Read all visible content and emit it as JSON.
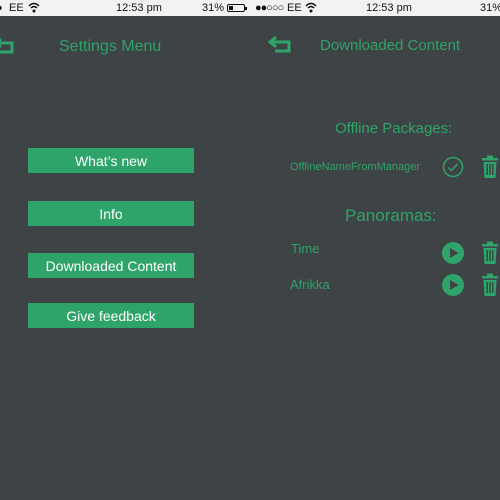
{
  "status_left": {
    "carrier": "EE",
    "time": "12:53 pm",
    "battery": "31%"
  },
  "status_right": {
    "signal": "●●○○○",
    "carrier": "EE",
    "time": "12:53 pm",
    "battery": "31%"
  },
  "settings_screen": {
    "title": "Settings Menu",
    "buttons": [
      "What’s new",
      "Info",
      "Downloaded Content",
      "Give feedback"
    ]
  },
  "downloaded_screen": {
    "title": "Downloaded Content",
    "offline_heading": "Offline Packages:",
    "offline_items": [
      "OfflineNameFromManager"
    ],
    "panoramas_heading": "Panoramas:",
    "panorama_items": [
      "Time",
      "Afrikka"
    ]
  },
  "colors": {
    "background": "#3e4345",
    "accent": "#2ea36a",
    "status_bar": "#f2f2f2"
  },
  "icons": [
    "back-arrow-icon",
    "check-circle-icon",
    "trash-icon",
    "play-icon",
    "wifi-icon",
    "battery-icon"
  ]
}
